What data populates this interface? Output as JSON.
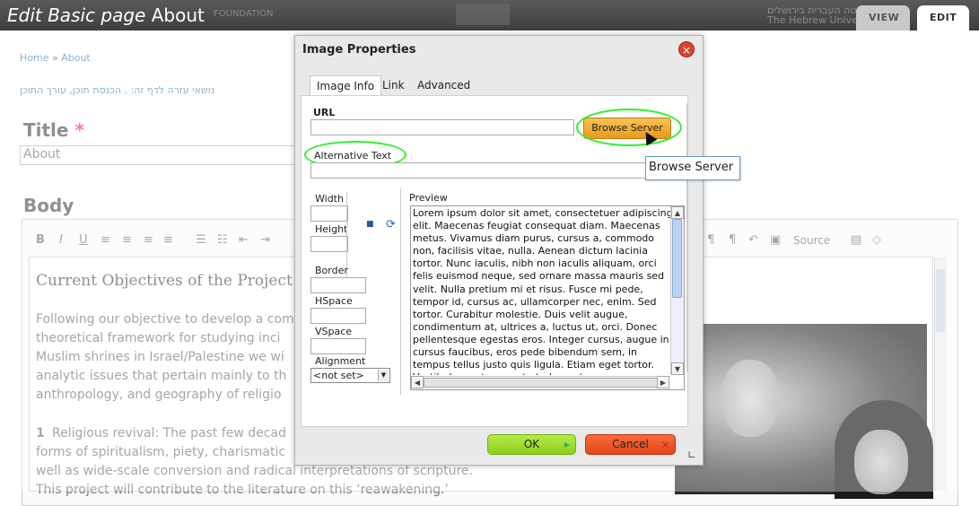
{
  "page": {
    "title_italic": "Edit Basic page",
    "title_name": "About",
    "logo_text": "FOUNDATION",
    "logo_right_1": "האוניברסיטה העברית בירושלים",
    "logo_right_2": "The Hebrew University",
    "tabs": [
      "VIEW",
      "EDIT"
    ],
    "breadcrumb": {
      "home": "Home",
      "sep": "»",
      "current": "About"
    },
    "help_text": "נושאי עזרה לדף זה: . הכנסת תוכן, עורך התוכן",
    "title_label": "Title",
    "required_mark": "*",
    "title_value": "About",
    "body_label": "Body"
  },
  "editor": {
    "toolbar": {
      "bold": "B",
      "italic": "I",
      "underline": "U",
      "align_left": "≡",
      "align_center": "≡",
      "align_right": "≡",
      "justify": "≡",
      "bullets": "☰",
      "numbers": "☷",
      "outdent": "⇤",
      "indent": "⇥",
      "ltr": "¶",
      "rtl": "¶",
      "undo": "↶",
      "image": "▣",
      "source": "Source",
      "paste": "▤",
      "eraser": "◇"
    },
    "heading": "Current Objectives of the Project",
    "paragraph_lines": [
      "Following our objective to develop a com",
      "theoretical framework for studying inci",
      "Muslim shrines in Israel/Palestine we wi",
      "analytic issues that pertain mainly to th",
      "anthropology, and geography of religio"
    ],
    "item_number": "1",
    "item_lines": [
      "Religious revival: The past few decad",
      "forms of spiritualism, piety, charismatic",
      "well as wide-scale conversion and radical interpretations of scripture.",
      "This project will contribute to the literature on this ‘reawakening.’"
    ]
  },
  "dialog": {
    "title": "Image Properties",
    "close_symbol": "×",
    "tabs": [
      "Image Info",
      "Link",
      "Advanced"
    ],
    "url_label": "URL",
    "url_value": "",
    "browse_label": "Browse Server",
    "alt_label": "Alternative Text",
    "alt_value": "",
    "width_label": "Width",
    "height_label": "Height",
    "border_label": "Border",
    "hspace_label": "HSpace",
    "vspace_label": "VSpace",
    "alignment_label": "Alignment",
    "alignment_value": "<not set>",
    "preview_label": "Preview",
    "preview_text": "Lorem ipsum dolor sit amet, consectetuer adipiscing elit. Maecenas feugiat consequat diam. Maecenas metus. Vivamus diam purus, cursus a, commodo non, facilisis vitae, nulla. Aenean dictum lacinia tortor. Nunc iaculis, nibh non iaculis aliquam, orci felis euismod neque, sed ornare massa mauris sed velit. Nulla pretium mi et risus. Fusce mi pede, tempor id, cursus ac, ullamcorper nec, enim. Sed tortor. Curabitur molestie. Duis velit augue, condimentum at, ultrices a, luctus ut, orci. Donec pellentesque egestas eros. Integer cursus, augue in cursus faucibus, eros pede bibendum sem, in tempus tellus justo quis ligula. Etiam eget tortor. Vestibulum rutrum, est ut placerat",
    "ok_label": "OK",
    "cancel_label": "Cancel"
  },
  "tooltip": "Browse Server",
  "colors": {
    "browse_button": "#f2ad3a",
    "ok_button": "#9fdc2f",
    "cancel_button": "#ef5a2a",
    "annotation_highlight": "#2ef02e",
    "link": "#4a8ab5"
  }
}
